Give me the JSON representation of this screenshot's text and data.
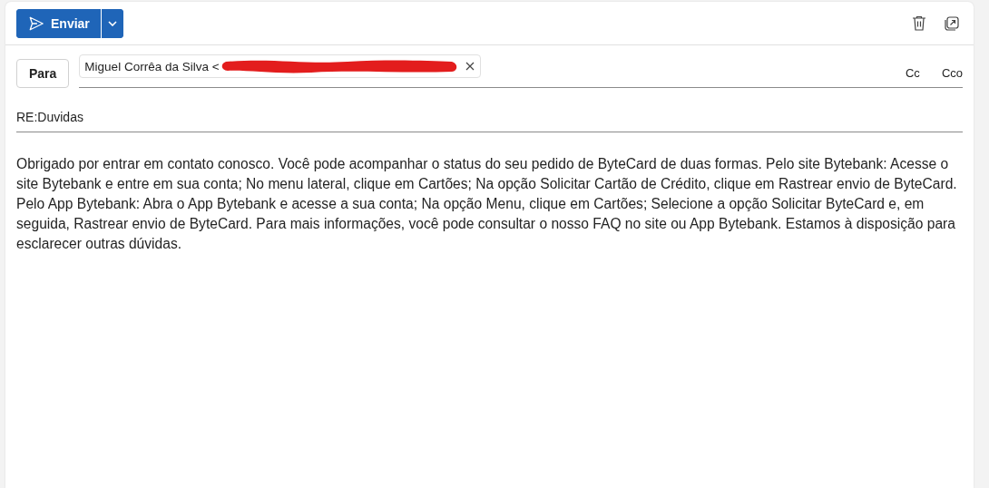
{
  "toolbar": {
    "send_button": {
      "label": "Enviar"
    }
  },
  "recipients": {
    "to_button": "Para",
    "chips": [
      {
        "text": "Miguel Corrêa da Silva <",
        "redacted": true
      }
    ],
    "cc": "Cc",
    "bcc": "Cco"
  },
  "subject": {
    "value": "RE:Duvidas"
  },
  "body": "Obrigado por entrar em contato conosco. Você pode acompanhar o status do seu pedido de ByteCard de duas formas. Pelo site Bytebank: Acesse o site Bytebank e entre em sua conta; No menu lateral, clique em Cartões; Na opção Solicitar Cartão de Crédito, clique em Rastrear envio de ByteCard. Pelo App Bytebank: Abra o App Bytebank e acesse a sua conta; Na opção Menu, clique em Cartões; Selecione a opção Solicitar ByteCard e, em seguida, Rastrear envio de ByteCard. Para mais informações, você pode consultar o nosso FAQ no site ou App Bytebank. Estamos à disposição para esclarecer outras dúvidas."
}
